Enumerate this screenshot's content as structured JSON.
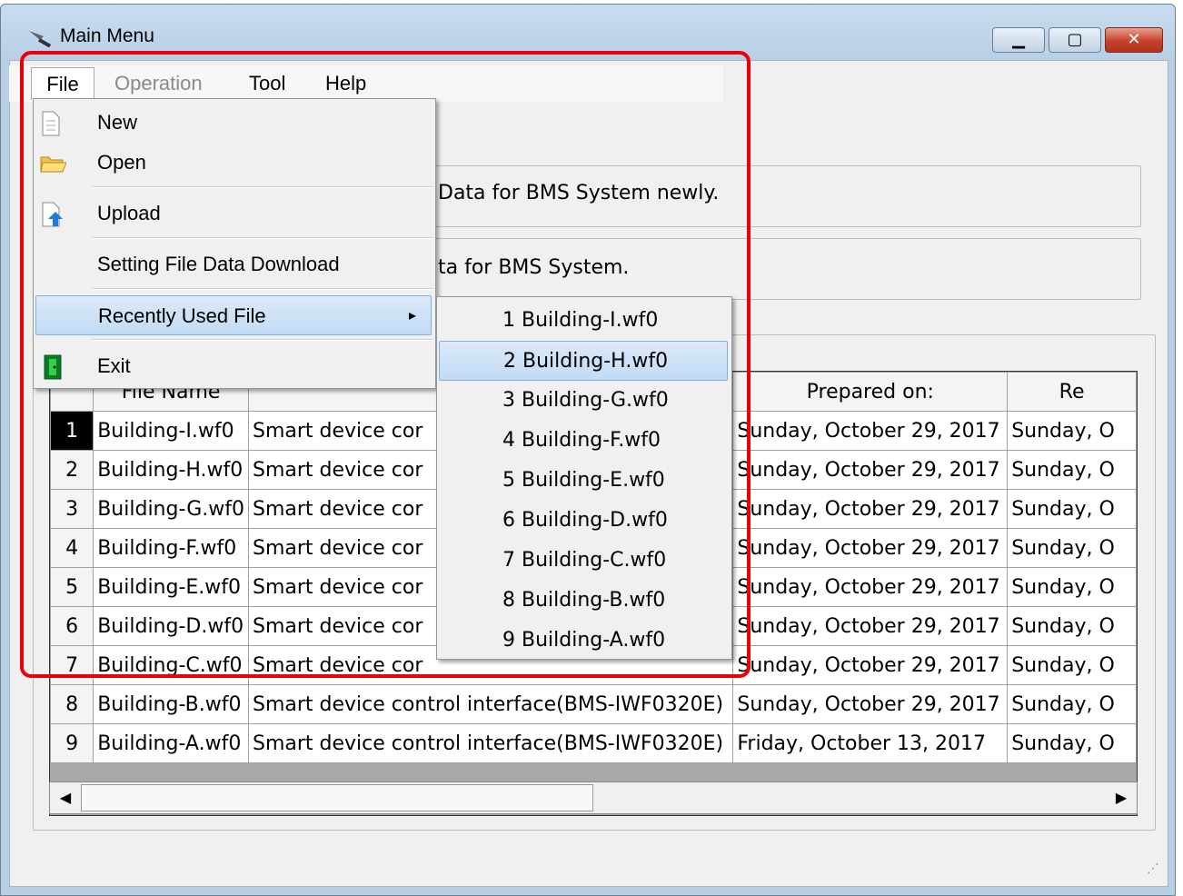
{
  "window": {
    "title": "Main Menu"
  },
  "menubar": {
    "file": "File",
    "operation": "Operation",
    "tool": "Tool",
    "help": "Help"
  },
  "panels": {
    "new_desc": "Data for BMS System newly.",
    "open_desc": "ta for BMS System."
  },
  "file_menu": {
    "items": [
      {
        "label": "New",
        "icon": "new-file-icon"
      },
      {
        "label": "Open",
        "icon": "folder-open-icon"
      },
      {
        "label": "Upload",
        "icon": "upload-icon"
      },
      {
        "label": "Setting File Data Download"
      },
      {
        "label": "Recently Used File",
        "arrow": "▸"
      },
      {
        "label": "Exit",
        "icon": "exit-icon"
      }
    ]
  },
  "recent_menu": {
    "items": [
      "1 Building-I.wf0",
      "2 Building-H.wf0",
      "3 Building-G.wf0",
      "4 Building-F.wf0",
      "5 Building-E.wf0",
      "6 Building-D.wf0",
      "7 Building-C.wf0",
      "8 Building-B.wf0",
      "9 Building-A.wf0"
    ],
    "selected_index": 1
  },
  "table": {
    "columns": [
      "",
      "File Name",
      "",
      "Prepared on:",
      "Re"
    ],
    "rows": [
      [
        "1",
        "Building-I.wf0",
        "Smart device cor",
        "Sunday, October 29, 2017",
        "Sunday, O"
      ],
      [
        "2",
        "Building-H.wf0",
        "Smart device cor",
        "Sunday, October 29, 2017",
        "Sunday, O"
      ],
      [
        "3",
        "Building-G.wf0",
        "Smart device cor",
        "Sunday, October 29, 2017",
        "Sunday, O"
      ],
      [
        "4",
        "Building-F.wf0",
        "Smart device cor",
        "Sunday, October 29, 2017",
        "Sunday, O"
      ],
      [
        "5",
        "Building-E.wf0",
        "Smart device cor",
        "Sunday, October 29, 2017",
        "Sunday, O"
      ],
      [
        "6",
        "Building-D.wf0",
        "Smart device cor",
        "Sunday, October 29, 2017",
        "Sunday, O"
      ],
      [
        "7",
        "Building-C.wf0",
        "Smart device cor",
        "Sunday, October 29, 2017",
        "Sunday, O"
      ],
      [
        "8",
        "Building-B.wf0",
        "Smart device control interface(BMS-IWF0320E)",
        "Sunday, October 29, 2017",
        "Sunday, O"
      ],
      [
        "9",
        "Building-A.wf0",
        "Smart device control interface(BMS-IWF0320E)",
        "Friday, October 13, 2017",
        "Sunday, O"
      ]
    ],
    "selected_row": 0
  },
  "colors": {
    "highlight_border": "#e8000b",
    "menu_highlight": "#c1dbf5"
  }
}
